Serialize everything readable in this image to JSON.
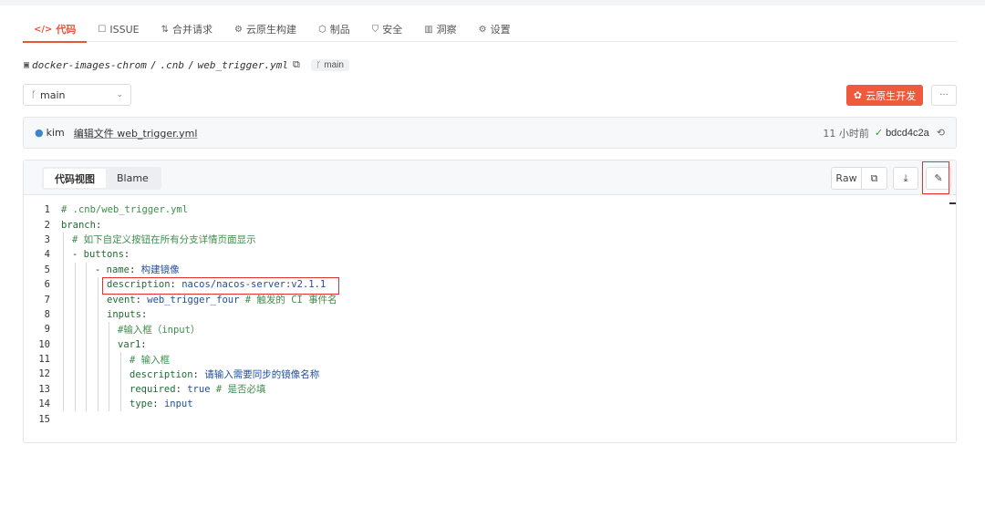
{
  "nav": {
    "tabs": [
      {
        "icon": "</>",
        "label": "代码",
        "active": true
      },
      {
        "icon": "☐",
        "label": "ISSUE"
      },
      {
        "icon": "⇅",
        "label": "合并请求"
      },
      {
        "icon": "⚙",
        "label": "云原生构建"
      },
      {
        "icon": "⬡",
        "label": "制品"
      },
      {
        "icon": "⛉",
        "label": "安全"
      },
      {
        "icon": "▥",
        "label": "洞察"
      },
      {
        "icon": "⚙",
        "label": "设置"
      }
    ]
  },
  "breadcrumb": {
    "repo": "docker-images-chrom",
    "dir": ".cnb",
    "file": "web_trigger.yml",
    "branch": "main"
  },
  "branch_select": {
    "value": "main"
  },
  "cloud_button": {
    "label": "云原生开发"
  },
  "more_button": {
    "label": "···"
  },
  "commit": {
    "author": "kim",
    "message": "编辑文件 web_trigger.yml",
    "time": "11 小时前",
    "hash": "bdcd4c2a"
  },
  "view_tabs": {
    "code_view": "代码视图",
    "blame": "Blame"
  },
  "tools": {
    "raw": "Raw"
  },
  "code_lines": [
    {
      "n": "1"
    },
    {
      "n": "2"
    },
    {
      "n": "3"
    },
    {
      "n": "4"
    },
    {
      "n": "5"
    },
    {
      "n": "6"
    },
    {
      "n": "7"
    },
    {
      "n": "8"
    },
    {
      "n": "9"
    },
    {
      "n": "10"
    },
    {
      "n": "11"
    },
    {
      "n": "12"
    },
    {
      "n": "13"
    },
    {
      "n": "14"
    },
    {
      "n": "15"
    }
  ],
  "code": {
    "l1": "# .cnb/web_trigger.yml",
    "l2_key": "branch",
    "l3": "# 如下自定义按钮在所有分支详情页面显示",
    "l4_key": "buttons",
    "l5_key": "name",
    "l5_val": "构建镜像",
    "l6_key": "description",
    "l6_val": "nacos/nacos-server:v2.1.1",
    "l7_key": "event",
    "l7_val": "web_trigger_four",
    "l7_cmt": "# 触发的 CI 事件名",
    "l8_key": "inputs",
    "l9": "#输入框（input）",
    "l10_key": "var1",
    "l11": "# 输入框",
    "l12_key": "description",
    "l12_val": "请输入需要同步的镜像名称",
    "l13_key": "required",
    "l13_val": "true",
    "l13_cmt": "# 是否必填",
    "l14_key": "type",
    "l14_val": "input"
  }
}
